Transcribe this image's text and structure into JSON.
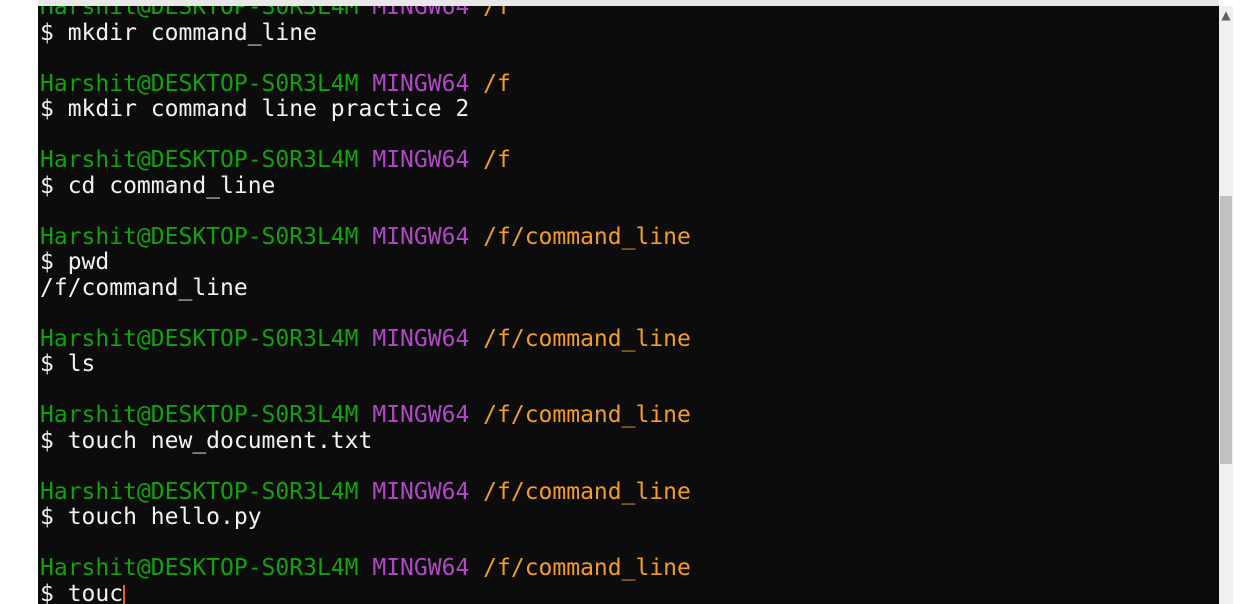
{
  "terminal": {
    "prompt": {
      "user_host": "Harshit@DESKTOP-S0R3L4M",
      "system": "MINGW64"
    },
    "lines": [
      {
        "type": "prompt",
        "path": "/f"
      },
      {
        "type": "command",
        "text": "$ mkdir command_line"
      },
      {
        "type": "blank"
      },
      {
        "type": "prompt",
        "path": "/f"
      },
      {
        "type": "command",
        "text": "$ mkdir command line practice 2"
      },
      {
        "type": "blank"
      },
      {
        "type": "prompt",
        "path": "/f"
      },
      {
        "type": "command",
        "text": "$ cd command_line"
      },
      {
        "type": "blank"
      },
      {
        "type": "prompt",
        "path": "/f/command_line"
      },
      {
        "type": "command",
        "text": "$ pwd"
      },
      {
        "type": "output",
        "text": "/f/command_line"
      },
      {
        "type": "blank"
      },
      {
        "type": "prompt",
        "path": "/f/command_line"
      },
      {
        "type": "command",
        "text": "$ ls"
      },
      {
        "type": "blank"
      },
      {
        "type": "prompt",
        "path": "/f/command_line"
      },
      {
        "type": "command",
        "text": "$ touch new_document.txt"
      },
      {
        "type": "blank"
      },
      {
        "type": "prompt",
        "path": "/f/command_line"
      },
      {
        "type": "command",
        "text": "$ touch hello.py"
      },
      {
        "type": "blank"
      },
      {
        "type": "prompt",
        "path": "/f/command_line"
      },
      {
        "type": "input",
        "text": "$ touc"
      }
    ]
  },
  "scrollbar": {
    "up_icon": "▲",
    "position": 0.55
  },
  "colors": {
    "background": "#0c0c0c",
    "user_host": "#13a10e",
    "system": "#b148c6",
    "path": "#f39c2b",
    "text": "#f2f2f2",
    "cursor": "#e85d2a"
  }
}
